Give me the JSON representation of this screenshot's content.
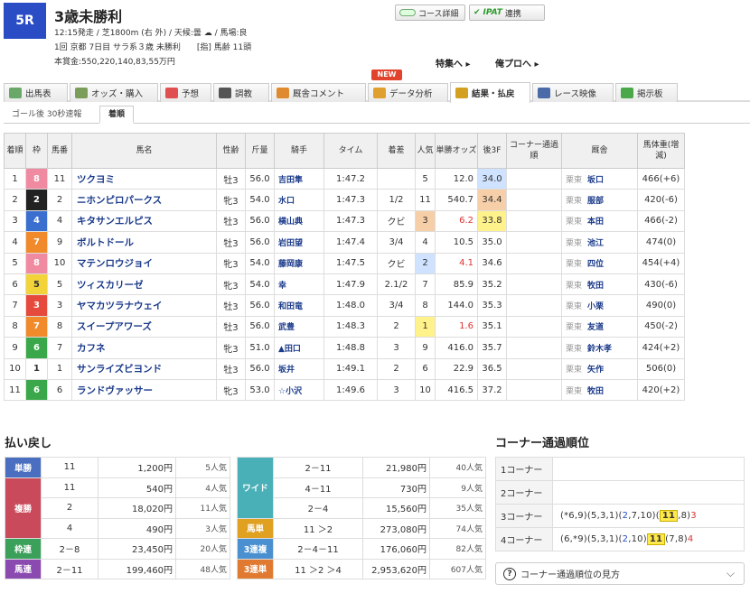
{
  "header": {
    "race_number": "5R",
    "race_name": "3歳未勝利",
    "line1": "12:15発走 / 芝1800m (右 外) / 天候:曇 ☁ / 馬場:良",
    "line2": "1回 京都 7日目 サラ系３歳 未勝利　　[指] 馬齢 11頭",
    "line3": "本賞金:550,220,140,83,55万円",
    "course_detail_btn": "コース詳細",
    "ipat_btn_brand": "IPAT",
    "ipat_btn_label": "連携",
    "special_link": "特集へ ▸",
    "pro_link": "俺プロへ ▸"
  },
  "tabs": [
    {
      "label": "出馬表",
      "icon": "table-icon",
      "color": "#6aa86a"
    },
    {
      "label": "オッズ・購入",
      "icon": "odds-icon",
      "color": "#7a9e5a"
    },
    {
      "label": "予想",
      "icon": "target-icon",
      "color": "#e05050"
    },
    {
      "label": "調教",
      "icon": "stopwatch-icon",
      "color": "#555555"
    },
    {
      "label": "厩舎コメント",
      "icon": "stable-icon",
      "color": "#e08a30"
    },
    {
      "label": "データ分析",
      "icon": "bar-chart-icon",
      "color": "#e0a030"
    },
    {
      "label": "結果・払戻",
      "icon": "coins-icon",
      "color": "#d4a020"
    },
    {
      "label": "レース映像",
      "icon": "video-icon",
      "color": "#4a6aa8"
    },
    {
      "label": "掲示板",
      "icon": "chat-icon",
      "color": "#4aa84a"
    }
  ],
  "new_badge": "NEW",
  "subtabs": {
    "goal_after": "ゴール後 30秒速報",
    "order": "着順"
  },
  "results_headers": [
    "着順",
    "枠",
    "馬番",
    "馬名",
    "性齢",
    "斤量",
    "騎手",
    "タイム",
    "着差",
    "人気",
    "単勝オッズ",
    "後3F",
    "コーナー通過順",
    "厩舎",
    "馬体重(増減)"
  ],
  "results": [
    {
      "rank": "1",
      "waku": "8",
      "num": "11",
      "name": "ツクヨミ",
      "sex": "牡3",
      "kin": "56.0",
      "jockey": "吉田隼",
      "time": "1:47.2",
      "margin": "",
      "pop": "5",
      "odds": "12.0",
      "last3f": "34.0",
      "corner": "",
      "loc": "栗東",
      "trainer": "坂口",
      "weight": "466(+6)",
      "pop_hl": "",
      "f3_hl": "#cfe2ff"
    },
    {
      "rank": "2",
      "waku": "2",
      "num": "2",
      "name": "ニホンピロパークス",
      "sex": "牝3",
      "kin": "54.0",
      "jockey": "水口",
      "time": "1:47.3",
      "margin": "1/2",
      "pop": "11",
      "odds": "540.7",
      "last3f": "34.4",
      "corner": "",
      "loc": "栗東",
      "trainer": "服部",
      "weight": "420(-6)",
      "pop_hl": "",
      "f3_hl": "#f6cfa8"
    },
    {
      "rank": "3",
      "waku": "4",
      "num": "4",
      "name": "キタサンエルピス",
      "sex": "牡3",
      "kin": "56.0",
      "jockey": "横山典",
      "time": "1:47.3",
      "margin": "クビ",
      "pop": "3",
      "odds": "6.2",
      "last3f": "33.8",
      "corner": "",
      "loc": "栗東",
      "trainer": "本田",
      "weight": "466(-2)",
      "pop_hl": "#f6cfa8",
      "f3_hl": "#fff28a"
    },
    {
      "rank": "4",
      "waku": "7",
      "num": "9",
      "name": "ボルトドール",
      "sex": "牡3",
      "kin": "56.0",
      "jockey": "岩田望",
      "time": "1:47.4",
      "margin": "3/4",
      "pop": "4",
      "odds": "10.5",
      "last3f": "35.0",
      "corner": "",
      "loc": "栗東",
      "trainer": "池江",
      "weight": "474(0)",
      "pop_hl": "",
      "f3_hl": ""
    },
    {
      "rank": "5",
      "waku": "8",
      "num": "10",
      "name": "マテンロウジョイ",
      "sex": "牝3",
      "kin": "54.0",
      "jockey": "藤岡康",
      "time": "1:47.5",
      "margin": "クビ",
      "pop": "2",
      "odds": "4.1",
      "last3f": "34.6",
      "corner": "",
      "loc": "栗東",
      "trainer": "四位",
      "weight": "454(+4)",
      "pop_hl": "#cfe2ff",
      "f3_hl": ""
    },
    {
      "rank": "6",
      "waku": "5",
      "num": "5",
      "name": "ツィスカリーゼ",
      "sex": "牝3",
      "kin": "54.0",
      "jockey": "幸",
      "time": "1:47.9",
      "margin": "2.1/2",
      "pop": "7",
      "odds": "85.9",
      "last3f": "35.2",
      "corner": "",
      "loc": "栗東",
      "trainer": "牧田",
      "weight": "430(-6)",
      "pop_hl": "",
      "f3_hl": ""
    },
    {
      "rank": "7",
      "waku": "3",
      "num": "3",
      "name": "ヤマカツラナウェイ",
      "sex": "牡3",
      "kin": "56.0",
      "jockey": "和田竜",
      "time": "1:48.0",
      "margin": "3/4",
      "pop": "8",
      "odds": "144.0",
      "last3f": "35.3",
      "corner": "",
      "loc": "栗東",
      "trainer": "小栗",
      "weight": "490(0)",
      "pop_hl": "",
      "f3_hl": ""
    },
    {
      "rank": "8",
      "waku": "7",
      "num": "8",
      "name": "スイープアワーズ",
      "sex": "牡3",
      "kin": "56.0",
      "jockey": "武豊",
      "time": "1:48.3",
      "margin": "2",
      "pop": "1",
      "odds": "1.6",
      "last3f": "35.1",
      "corner": "",
      "loc": "栗東",
      "trainer": "友道",
      "weight": "450(-2)",
      "pop_hl": "#fff28a",
      "f3_hl": ""
    },
    {
      "rank": "9",
      "waku": "6",
      "num": "7",
      "name": "カフネ",
      "sex": "牝3",
      "kin": "51.0",
      "jockey": "▲田口",
      "time": "1:48.8",
      "margin": "3",
      "pop": "9",
      "odds": "416.0",
      "last3f": "35.7",
      "corner": "",
      "loc": "栗東",
      "trainer": "鈴木孝",
      "weight": "424(+2)",
      "pop_hl": "",
      "f3_hl": ""
    },
    {
      "rank": "10",
      "waku": "1",
      "num": "1",
      "name": "サンライズビヨンド",
      "sex": "牡3",
      "kin": "56.0",
      "jockey": "坂井",
      "time": "1:49.1",
      "margin": "2",
      "pop": "6",
      "odds": "22.9",
      "last3f": "36.5",
      "corner": "",
      "loc": "栗東",
      "trainer": "矢作",
      "weight": "506(0)",
      "pop_hl": "",
      "f3_hl": ""
    },
    {
      "rank": "11",
      "waku": "6",
      "num": "6",
      "name": "ランドヴァッサー",
      "sex": "牝3",
      "kin": "53.0",
      "jockey": "☆小沢",
      "time": "1:49.6",
      "margin": "3",
      "pop": "10",
      "odds": "416.5",
      "last3f": "37.2",
      "corner": "",
      "loc": "栗東",
      "trainer": "牧田",
      "weight": "420(+2)",
      "pop_hl": "",
      "f3_hl": ""
    }
  ],
  "waku_colors": {
    "1": "#ffffff",
    "2": "#222222",
    "3": "#e64a3c",
    "4": "#3a6fd0",
    "5": "#f2d43a",
    "6": "#3aa84a",
    "7": "#f08a2a",
    "8": "#f08aa0"
  },
  "odds_red_threshold": 10,
  "payout_title": "払い戻し",
  "payout_left": [
    {
      "label": "単勝",
      "color": "#4a6fc0",
      "rows": [
        {
          "combo": "11",
          "yen": "1,200円",
          "pop": "5人気"
        }
      ]
    },
    {
      "label": "複勝",
      "color": "#c94a5a",
      "rows": [
        {
          "combo": "11",
          "yen": "540円",
          "pop": "4人気"
        },
        {
          "combo": "2",
          "yen": "18,020円",
          "pop": "11人気"
        },
        {
          "combo": "4",
          "yen": "490円",
          "pop": "3人気"
        }
      ]
    },
    {
      "label": "枠連",
      "color": "#3aa05a",
      "rows": [
        {
          "combo": "2－8",
          "yen": "23,450円",
          "pop": "20人気"
        }
      ]
    },
    {
      "label": "馬連",
      "color": "#8a4ab0",
      "rows": [
        {
          "combo": "2－11",
          "yen": "199,460円",
          "pop": "48人気"
        }
      ]
    }
  ],
  "payout_right": [
    {
      "label": "ワイド",
      "color": "#4ab0b8",
      "rows": [
        {
          "combo": "2－11",
          "yen": "21,980円",
          "pop": "40人気"
        },
        {
          "combo": "4－11",
          "yen": "730円",
          "pop": "9人気"
        },
        {
          "combo": "2－4",
          "yen": "15,560円",
          "pop": "35人気"
        }
      ]
    },
    {
      "label": "馬単",
      "color": "#e0a020",
      "rows": [
        {
          "combo": "11 ＞2",
          "yen": "273,080円",
          "pop": "74人気"
        }
      ]
    },
    {
      "label": "3連複",
      "color": "#4a90d0",
      "rows": [
        {
          "combo": "2－4－11",
          "yen": "176,060円",
          "pop": "82人気"
        }
      ]
    },
    {
      "label": "3連単",
      "color": "#e07a30",
      "rows": [
        {
          "combo": "11 ＞2 ＞4",
          "yen": "2,953,620円",
          "pop": "607人気"
        }
      ]
    }
  ],
  "corner_title": "コーナー通過順位",
  "corners": [
    {
      "label": "1コーナー",
      "value": ""
    },
    {
      "label": "2コーナー",
      "value": ""
    },
    {
      "label": "3コーナー",
      "value": "3"
    },
    {
      "label": "4コーナー",
      "value": "4"
    }
  ],
  "corner_help": "コーナー通過順位の見方"
}
